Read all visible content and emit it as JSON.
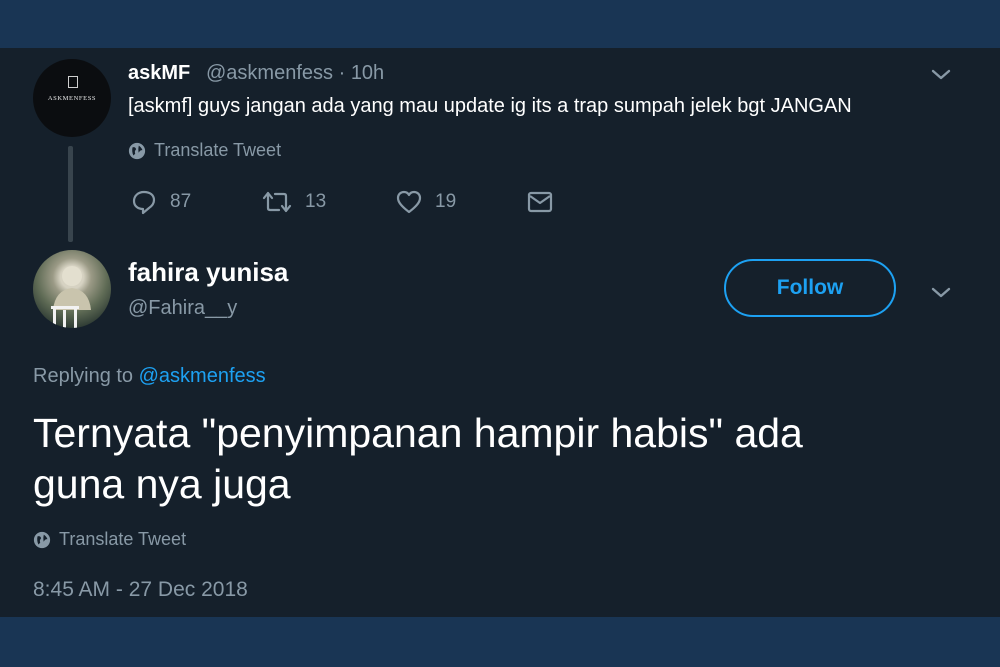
{
  "parent_tweet": {
    "avatar_logo_text": "ASKMENFESS",
    "name": "askMF",
    "handle": "@askmenfess",
    "separator": "·",
    "time": "10h",
    "text": "[askmf] guys jangan ada yang mau update ig its a trap sumpah jelek bgt JANGAN",
    "translate_label": "Translate Tweet",
    "counts": {
      "replies": "87",
      "retweets": "13",
      "likes": "19"
    }
  },
  "main_tweet": {
    "name": "fahira yunisa",
    "handle": "@Fahira__y",
    "follow_label": "Follow",
    "replying_prefix": "Replying to",
    "replying_to": "@askmenfess",
    "text_line1": "Ternyata \"penyimpanan hampir habis\" ada",
    "text_line2": "guna nya juga",
    "translate_label": "Translate Tweet",
    "timestamp": "8:45 AM - 27 Dec 2018"
  },
  "colors": {
    "background": "#15202b",
    "band": "#193554",
    "accent": "#1da1f2",
    "muted": "#8899a6",
    "text": "#ffffff"
  },
  "icons": [
    "globe-icon",
    "reply-icon",
    "retweet-icon",
    "heart-icon",
    "mail-icon",
    "chevron-down-icon"
  ]
}
